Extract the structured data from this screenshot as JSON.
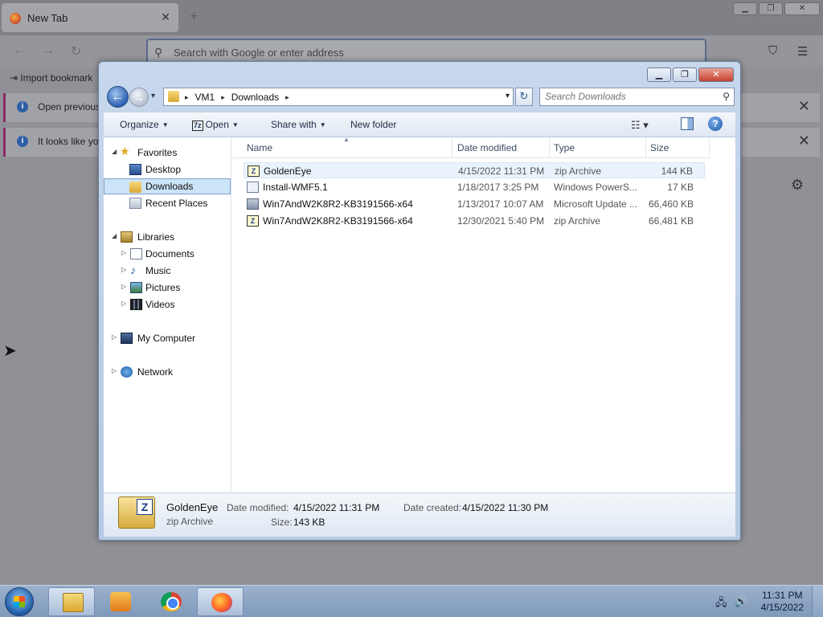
{
  "browser": {
    "tab_title": "New Tab",
    "tab_close": "✕",
    "new_tab": "+",
    "url_placeholder": "Search with Google or enter address",
    "import_bookmarks": "Import bookmark",
    "notice1": "Open previous",
    "notice2": "It looks like you",
    "close_glyph": "✕",
    "gear_glyph": "⚙",
    "back_glyph": "←",
    "forward_glyph": "→",
    "reload_glyph": "↻",
    "min_glyph": "▁",
    "max_glyph": "❐",
    "win_close_glyph": "✕",
    "pocket_glyph": "⛉",
    "menu_glyph": "☰",
    "search_glyph": "⚲",
    "info_glyph": "i",
    "import_glyph": "⇥"
  },
  "explorer": {
    "controls": {
      "minimize": "▁",
      "maximize": "❐",
      "close": "✕"
    },
    "nav": {
      "back_glyph": "←",
      "forward_glyph": "→",
      "history_glyph": "▾"
    },
    "address": {
      "crumbs": [
        "VM1",
        "Downloads"
      ],
      "sep_glyph": "▸",
      "drop_glyph": "▾",
      "refresh_glyph": "↻"
    },
    "search": {
      "placeholder": "Search Downloads",
      "glyph": "⚲"
    },
    "toolbar": {
      "organize": "Organize",
      "open": "Open",
      "open_icon": "7z",
      "share_with": "Share with",
      "new_folder": "New folder",
      "caret": "▼",
      "view_glyph": "☷ ▾",
      "help_glyph": "?"
    },
    "navpane": {
      "expanded_glyph": "◢",
      "collapsed_glyph": "▷",
      "star_glyph": "★",
      "music_glyph": "♪",
      "favorites": "Favorites",
      "desktop": "Desktop",
      "downloads": "Downloads",
      "recent_places": "Recent Places",
      "libraries": "Libraries",
      "documents": "Documents",
      "music": "Music",
      "pictures": "Pictures",
      "videos": "Videos",
      "my_computer": "My Computer",
      "network": "Network"
    },
    "columns": {
      "name": "Name",
      "date_modified": "Date modified",
      "type": "Type",
      "size": "Size",
      "sort_glyph": "▲"
    },
    "files": [
      {
        "name": "GoldenEye",
        "date": "4/15/2022 11:31 PM",
        "type": "zip Archive",
        "size": "144 KB",
        "icon_glyph": "Z"
      },
      {
        "name": "Install-WMF5.1",
        "date": "1/18/2017 3:25 PM",
        "type": "Windows PowerS...",
        "size": "17 KB",
        "icon_glyph": ""
      },
      {
        "name": "Win7AndW2K8R2-KB3191566-x64",
        "date": "1/13/2017 10:07 AM",
        "type": "Microsoft Update ...",
        "size": "66,460 KB",
        "icon_glyph": ""
      },
      {
        "name": "Win7AndW2K8R2-KB3191566-x64",
        "date": "12/30/2021 5:40 PM",
        "type": "zip Archive",
        "size": "66,481 KB",
        "icon_glyph": "Z"
      }
    ],
    "details": {
      "icon_glyph": "Z",
      "name": "GoldenEye",
      "type": "zip Archive",
      "date_modified_label": "Date modified:",
      "date_modified": "4/15/2022 11:31 PM",
      "size_label": "Size:",
      "size": "143 KB",
      "date_created_label": "Date created:",
      "date_created": "4/15/2022 11:30 PM"
    }
  },
  "taskbar": {
    "tray_network_glyph": "🖧",
    "tray_volume_glyph": "🔊",
    "time": "11:31 PM",
    "date": "4/15/2022"
  },
  "cursor_glyph": "➤"
}
